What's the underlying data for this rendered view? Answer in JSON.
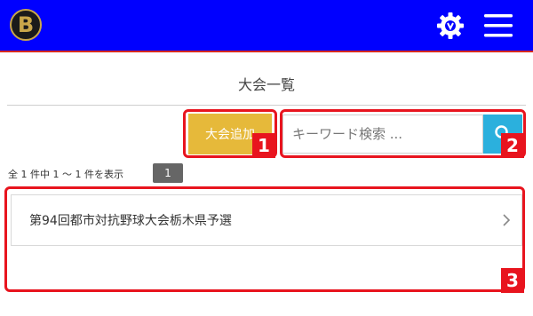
{
  "header": {
    "logo_letter": "B",
    "logo_icon": "brand-logo-icon",
    "settings_icon": "gear-icon",
    "menu_icon": "hamburger-menu-icon",
    "background_color": "#0000ff",
    "accent_line_color": "#d6281f"
  },
  "page": {
    "title": "大会一覧"
  },
  "toolbar": {
    "add_label": "大会追加",
    "search_placeholder": "キーワード検索 ...",
    "search_icon": "search-icon",
    "add_color": "#e6b93a",
    "search_button_color": "#2bb0dd"
  },
  "pagination": {
    "summary": "全 1 件中 1 ～ 1 件を表示",
    "current_page": "1"
  },
  "tournaments": [
    {
      "name": "第94回都市対抗野球大会栃木県予選"
    }
  ],
  "annotations": {
    "color": "#e8141e",
    "labels": [
      "1",
      "2",
      "3"
    ]
  }
}
